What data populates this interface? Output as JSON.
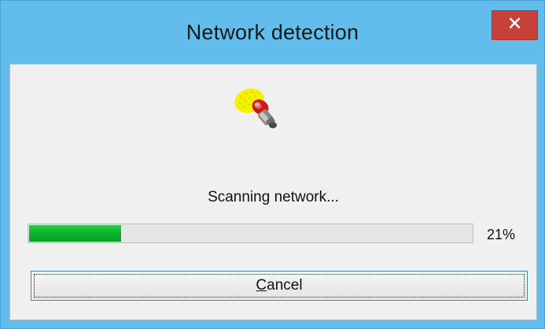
{
  "window": {
    "title": "Network detection",
    "close_glyph": "✕"
  },
  "icon": {
    "name": "network-scan-icon"
  },
  "status_text": "Scanning network...",
  "progress": {
    "value_percent": 21,
    "label": "21%",
    "fill_color": "#06b025"
  },
  "cancel_button": {
    "mnemonic": "C",
    "rest": "ancel"
  },
  "colors": {
    "frame": "#62bdec",
    "close_button": "#c7403a",
    "client_bg": "#f0f0f0"
  }
}
